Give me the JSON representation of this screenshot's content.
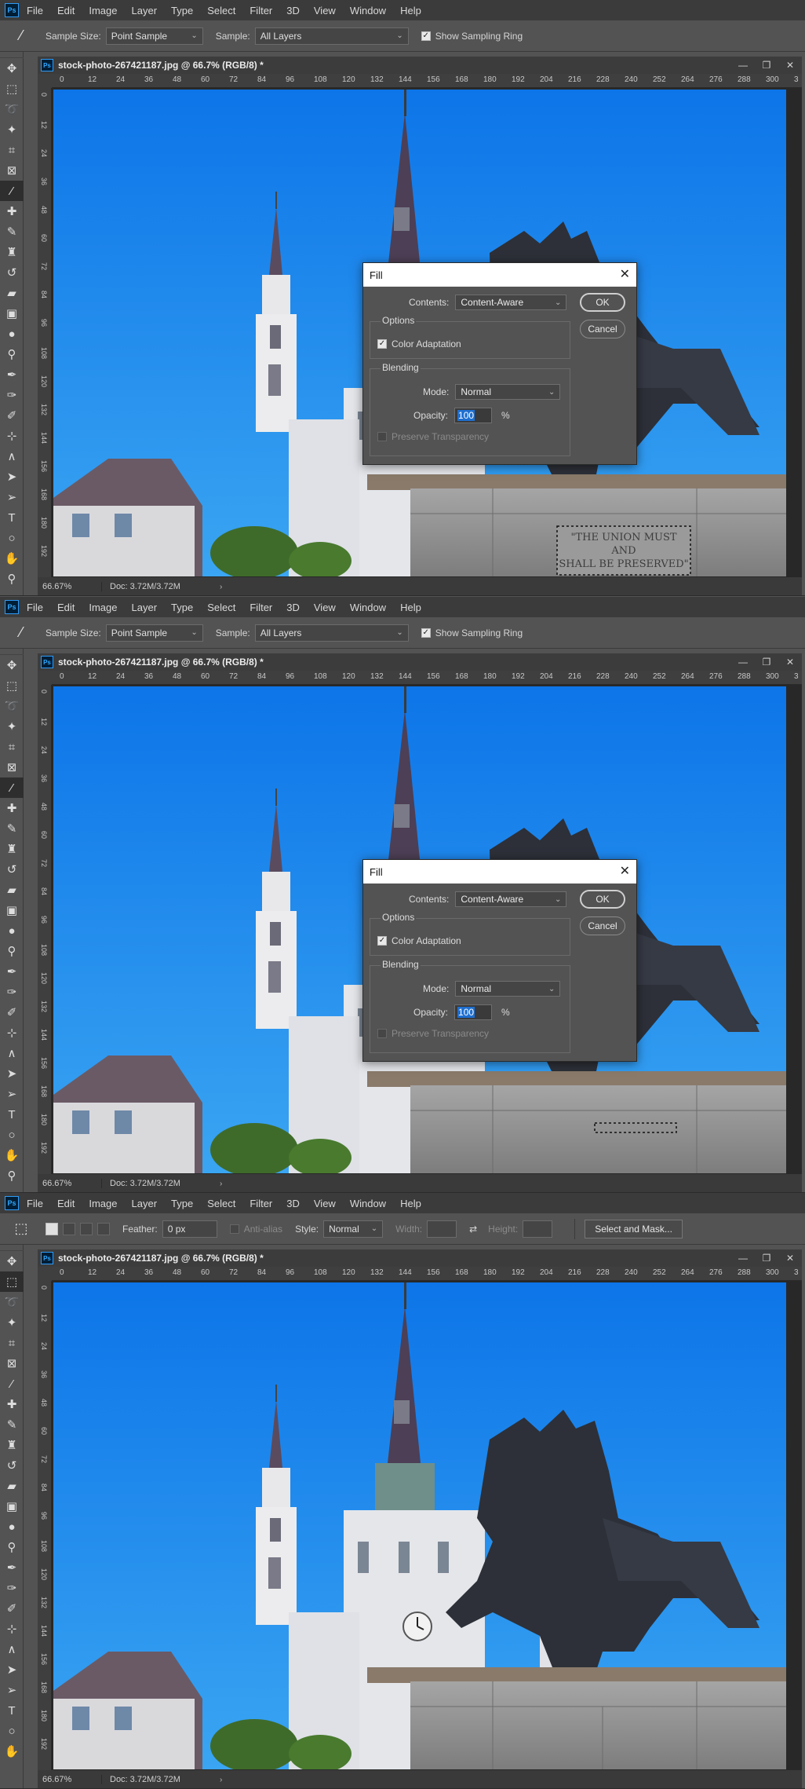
{
  "menu": [
    "File",
    "Edit",
    "Image",
    "Layer",
    "Type",
    "Select",
    "Filter",
    "3D",
    "View",
    "Window",
    "Help"
  ],
  "app_logo": "Ps",
  "window_controls": {
    "minimize": "—",
    "maximize": "❐",
    "close": "✕"
  },
  "eyedropper_options": {
    "sample_size_label": "Sample Size:",
    "sample_size_value": "Point Sample",
    "sample_label": "Sample:",
    "sample_value": "All Layers",
    "show_sampling_ring": "Show Sampling Ring"
  },
  "marquee_options": {
    "feather_label": "Feather:",
    "feather_value": "0 px",
    "anti_alias": "Anti-alias",
    "style_label": "Style:",
    "style_value": "Normal",
    "width_label": "Width:",
    "height_label": "Height:",
    "select_and_mask": "Select and Mask..."
  },
  "document": {
    "title": "stock-photo-267421187.jpg @ 66.7% (RGB/8) *",
    "zoom": "66.67%",
    "doc_size": "Doc: 3.72M/3.72M",
    "ruler_ticks": [
      "0",
      "12",
      "24",
      "36",
      "48",
      "60",
      "72",
      "84",
      "96",
      "108",
      "120",
      "132",
      "144",
      "156",
      "168",
      "180",
      "192",
      "204",
      "216",
      "228",
      "240",
      "252",
      "264",
      "276",
      "288",
      "300",
      "3"
    ]
  },
  "fill_dialog": {
    "title": "Fill",
    "contents_label": "Contents:",
    "contents_value": "Content-Aware",
    "ok": "OK",
    "cancel": "Cancel",
    "options_label": "Options",
    "color_adaptation": "Color Adaptation",
    "blending_label": "Blending",
    "mode_label": "Mode:",
    "mode_value": "Normal",
    "opacity_label": "Opacity:",
    "opacity_value": "100",
    "opacity_unit": "%",
    "preserve_transparency": "Preserve Transparency"
  },
  "plaque_text": [
    "\"THE UNION MUST",
    "AND",
    "SHALL BE PRESERVED\""
  ],
  "colors": {
    "sky": "#1a86ec",
    "accent": "#31a8ff",
    "ui_bg": "#535353"
  }
}
